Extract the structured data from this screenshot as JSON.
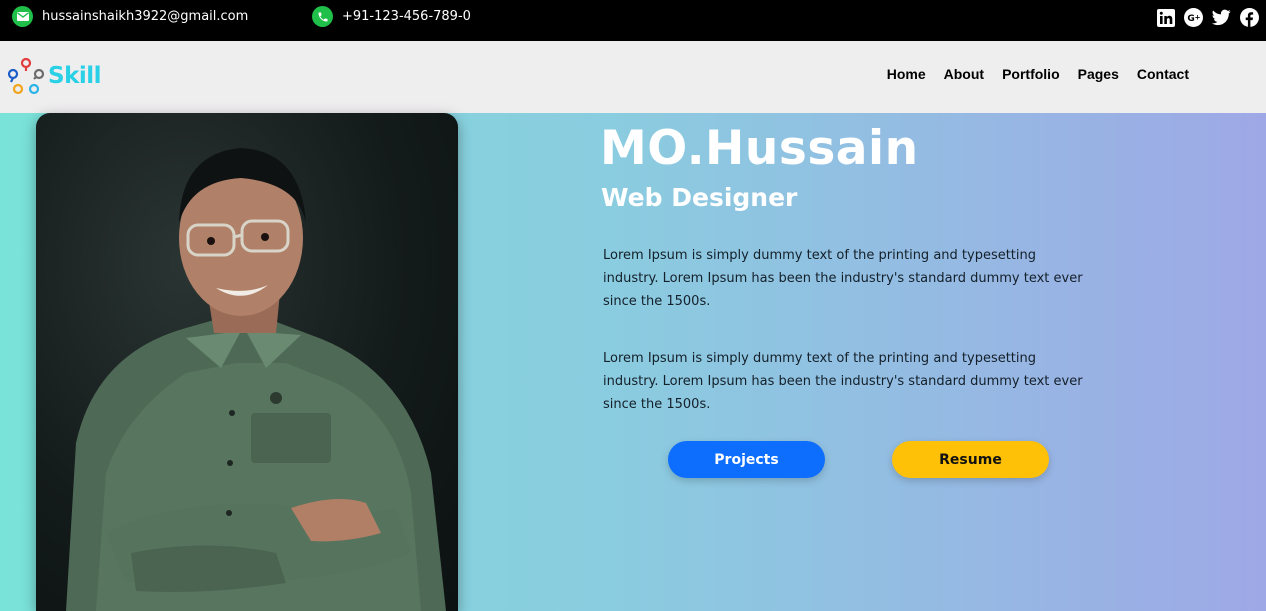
{
  "topbar": {
    "email": "hussainshaikh3922@gmail.com",
    "phone": "+91-123-456-789-0",
    "email_icon": "envelope-icon",
    "phone_icon": "phone-icon",
    "social": [
      "linkedin-icon",
      "google-plus-icon",
      "twitter-icon",
      "facebook-icon"
    ]
  },
  "nav": {
    "logo_text": "Skill",
    "items": [
      "Home",
      "About",
      "Portfolio",
      "Pages",
      "Contact"
    ]
  },
  "hero": {
    "name": "MO.Hussain",
    "role": "Web Designer",
    "paragraphs": [
      "Lorem Ipsum is simply dummy text of the printing and typesetting industry. Lorem Ipsum has been the industry's standard dummy text ever since the 1500s.",
      "Lorem Ipsum is simply dummy text of the printing and typesetting industry. Lorem Ipsum has been the industry's standard dummy text ever since the 1500s."
    ],
    "buttons": {
      "projects": "Projects",
      "resume": "Resume"
    }
  },
  "colors": {
    "topbar_bg": "#000000",
    "nav_bg": "#efeeef",
    "logo": "#2ad0e6",
    "contact_icon_bg": "#1fbf4a",
    "gradient_start": "#79e3d9",
    "gradient_end": "#9ea8e6",
    "projects_button": "#0d6efd",
    "resume_button": "#ffc107"
  }
}
